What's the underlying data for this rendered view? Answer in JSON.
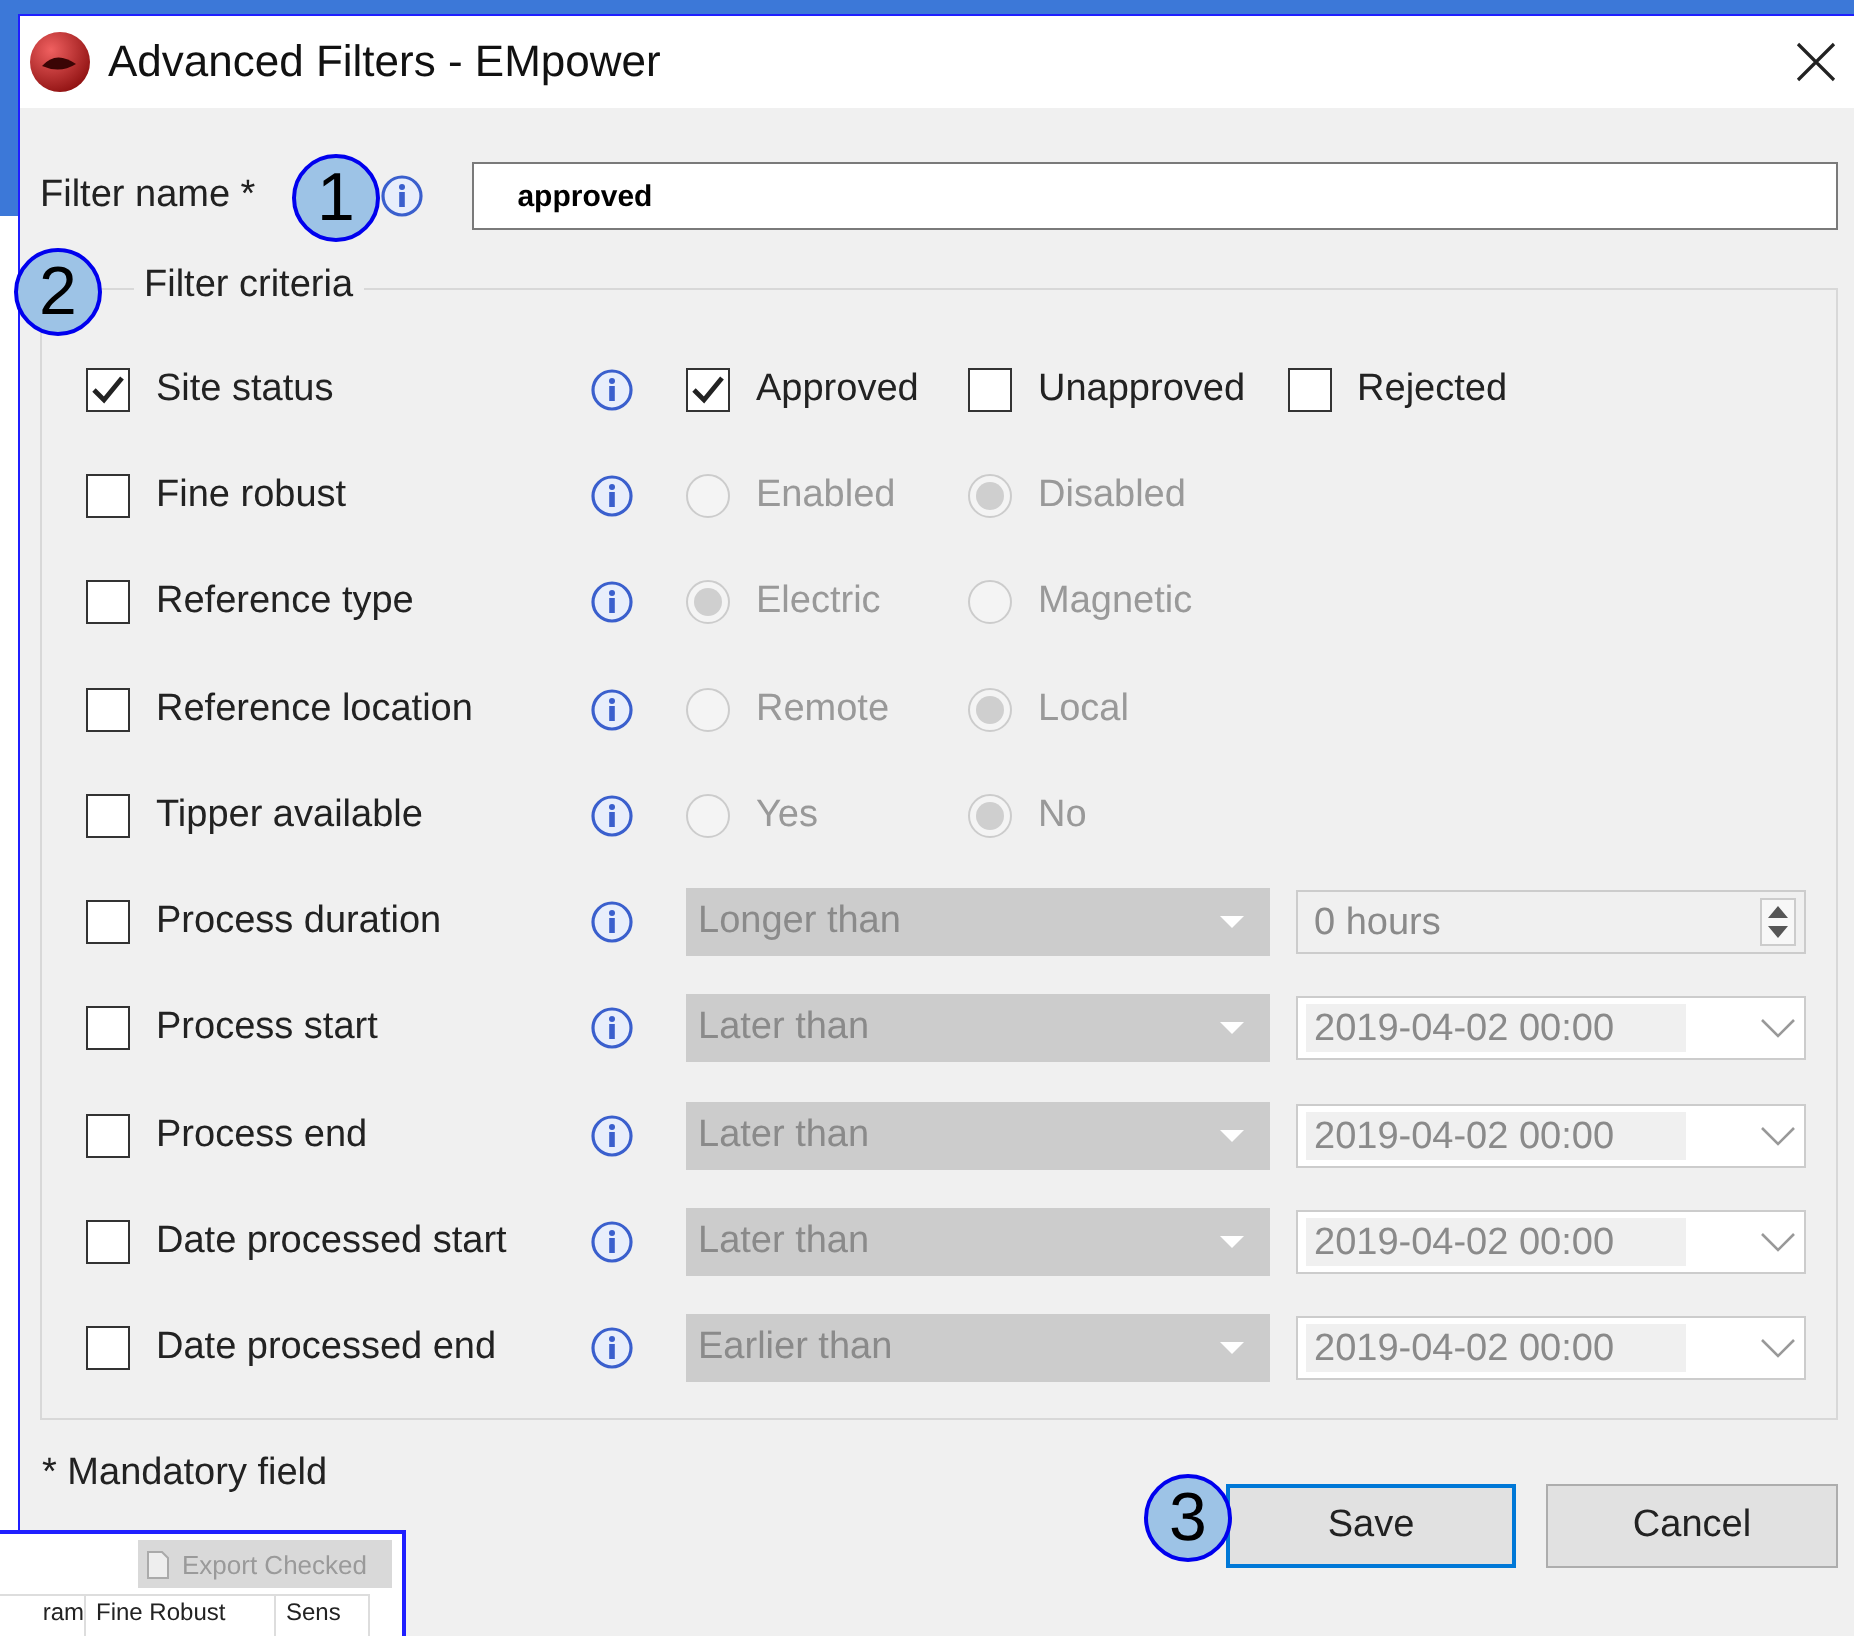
{
  "dialog": {
    "title": "Advanced Filters - EMpower"
  },
  "filter_name": {
    "label": "Filter name *",
    "value": "approved"
  },
  "filter_criteria": {
    "title": "Filter criteria",
    "rows": [
      {
        "label": "Site status",
        "checked": true,
        "kind": "checkboxes",
        "options": [
          {
            "label": "Approved",
            "selected": true
          },
          {
            "label": "Unapproved",
            "selected": false
          },
          {
            "label": "Rejected",
            "selected": false
          }
        ]
      },
      {
        "label": "Fine robust",
        "checked": false,
        "kind": "radios",
        "options": [
          {
            "label": "Enabled",
            "selected": false
          },
          {
            "label": "Disabled",
            "selected": true
          }
        ]
      },
      {
        "label": "Reference type",
        "checked": false,
        "kind": "radios",
        "options": [
          {
            "label": "Electric",
            "selected": true
          },
          {
            "label": "Magnetic",
            "selected": false
          }
        ]
      },
      {
        "label": "Reference location",
        "checked": false,
        "kind": "radios",
        "options": [
          {
            "label": "Remote",
            "selected": false
          },
          {
            "label": "Local",
            "selected": true
          }
        ]
      },
      {
        "label": "Tipper available",
        "checked": false,
        "kind": "radios",
        "options": [
          {
            "label": "Yes",
            "selected": false
          },
          {
            "label": "No",
            "selected": true
          }
        ]
      },
      {
        "label": "Process duration",
        "checked": false,
        "kind": "spin",
        "comparison": "Longer than",
        "value": "0 hours"
      },
      {
        "label": "Process start",
        "checked": false,
        "kind": "date",
        "comparison": "Later than",
        "value": "2019-04-02 00:00"
      },
      {
        "label": "Process end",
        "checked": false,
        "kind": "date",
        "comparison": "Later than",
        "value": "2019-04-02 00:00"
      },
      {
        "label": "Date processed start",
        "checked": false,
        "kind": "date",
        "comparison": "Later than",
        "value": "2019-04-02 00:00"
      },
      {
        "label": "Date processed end",
        "checked": false,
        "kind": "date",
        "comparison": "Earlier than",
        "value": "2019-04-02 00:00"
      }
    ]
  },
  "mandatory_note": "* Mandatory field",
  "buttons": [
    {
      "label": "Save",
      "selected": true
    },
    {
      "label": "Cancel",
      "selected": false
    }
  ],
  "background_window": {
    "export_button": "Export Checked",
    "columns": [
      "ram",
      "Fine Robust",
      "Sens"
    ]
  },
  "callouts": [
    "1",
    "2",
    "3"
  ]
}
